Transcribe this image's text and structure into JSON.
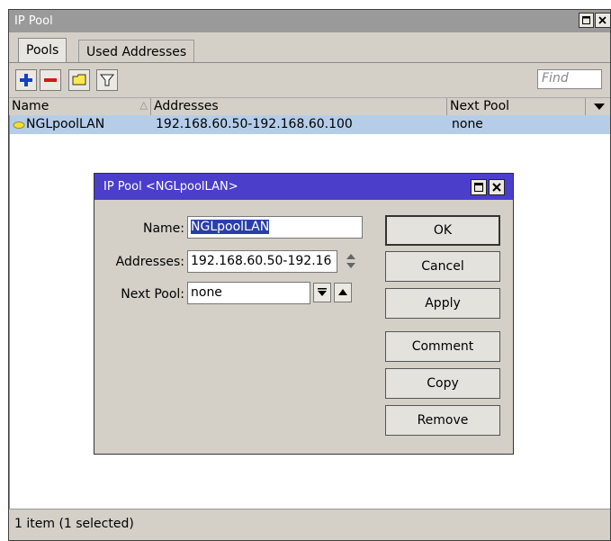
{
  "window": {
    "title": "IP Pool",
    "tabs": [
      "Pools",
      "Used Addresses"
    ],
    "active_tab": "Pools",
    "find_placeholder": "Find"
  },
  "table": {
    "columns": [
      "Name",
      "Addresses",
      "Next Pool"
    ],
    "rows": [
      {
        "name": "NGLpoolLAN",
        "addresses": "192.168.60.50-192.168.60.100",
        "next_pool": "none",
        "selected": true
      }
    ]
  },
  "status": {
    "text": "1 item (1 selected)"
  },
  "dialog": {
    "title": "IP Pool <NGLpoolLAN>",
    "name_label": "Name:",
    "name_value": "NGLpoolLAN",
    "addresses_label": "Addresses:",
    "addresses_value": "192.168.60.50-192.16",
    "next_pool_label": "Next Pool:",
    "next_pool_value": "none",
    "buttons": [
      "OK",
      "Cancel",
      "Apply",
      "Comment",
      "Copy",
      "Remove"
    ]
  },
  "colors": {
    "dialog_title": "#4b3ecb",
    "selected_row": "#b5cde8",
    "title_bar": "#9a9a9a"
  }
}
